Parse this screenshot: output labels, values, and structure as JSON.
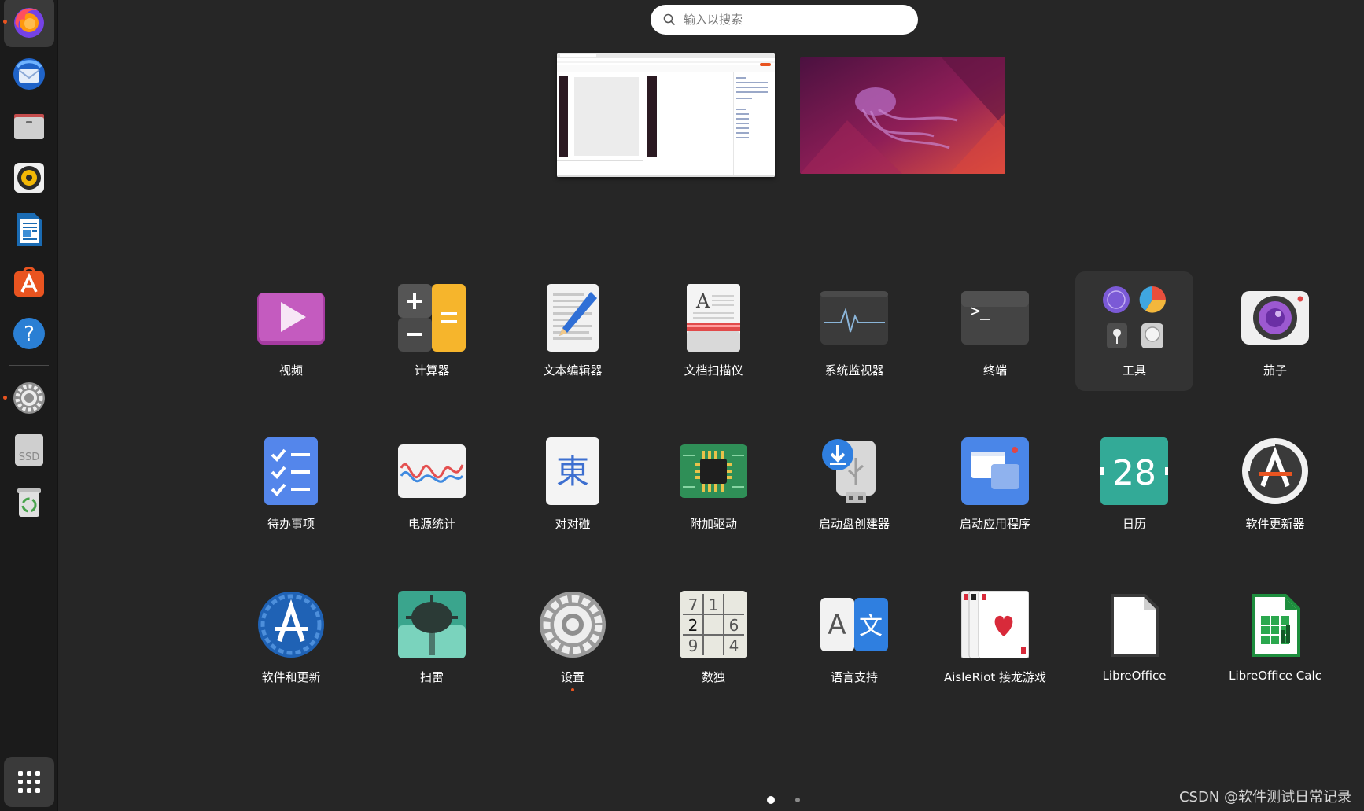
{
  "search": {
    "placeholder": "输入以搜索"
  },
  "dock": {
    "items": [
      {
        "name": "firefox",
        "icon": "firefox-icon",
        "running": true,
        "active": true
      },
      {
        "name": "thunderbird",
        "icon": "thunderbird-icon"
      },
      {
        "name": "files",
        "icon": "files-folder-icon"
      },
      {
        "name": "rhythmbox",
        "icon": "rhythmbox-speaker-icon"
      },
      {
        "name": "libreoffice-writer",
        "icon": "writer-document-icon"
      },
      {
        "name": "app-center",
        "icon": "app-center-icon"
      },
      {
        "name": "help",
        "icon": "help-icon"
      },
      {
        "name": "settings",
        "icon": "settings-gear-icon",
        "running": true
      },
      {
        "name": "ssd-drive",
        "icon": "ssd-drive-icon",
        "label": "SSD"
      },
      {
        "name": "trash",
        "icon": "trash-recycle-icon"
      },
      {
        "name": "show-apps",
        "icon": "app-grid-icon"
      }
    ]
  },
  "apps": [
    {
      "label": "视频",
      "icon": "video-play-icon"
    },
    {
      "label": "计算器",
      "icon": "calculator-icon"
    },
    {
      "label": "文本编辑器",
      "icon": "text-editor-icon"
    },
    {
      "label": "文档扫描仪",
      "icon": "document-scanner-icon"
    },
    {
      "label": "系统监视器",
      "icon": "system-monitor-icon"
    },
    {
      "label": "终端",
      "icon": "terminal-icon",
      "glyph": ">_"
    },
    {
      "label": "工具",
      "icon": "tools-folder-icon"
    },
    {
      "label": "茄子",
      "icon": "cheese-camera-icon"
    },
    {
      "label": "待办事项",
      "icon": "todo-checklist-icon"
    },
    {
      "label": "电源统计",
      "icon": "power-statistics-icon"
    },
    {
      "label": "对对碰",
      "icon": "mahjongg-tile-icon",
      "glyph": "東"
    },
    {
      "label": "附加驱动",
      "icon": "chip-driver-icon"
    },
    {
      "label": "启动盘创建器",
      "icon": "usb-creator-icon"
    },
    {
      "label": "启动应用程序",
      "icon": "startup-apps-icon"
    },
    {
      "label": "日历",
      "icon": "calendar-icon",
      "glyph": "28"
    },
    {
      "label": "软件更新器",
      "icon": "software-updater-icon"
    },
    {
      "label": "软件和更新",
      "icon": "software-properties-icon"
    },
    {
      "label": "扫雷",
      "icon": "mines-icon"
    },
    {
      "label": "设置",
      "icon": "settings-icon",
      "running": true
    },
    {
      "label": "数独",
      "icon": "sudoku-icon",
      "digits": [
        "7",
        "1",
        "2",
        "6",
        "9",
        "4"
      ]
    },
    {
      "label": "语言支持",
      "icon": "language-support-icon",
      "glyphs": [
        "A",
        "文"
      ]
    },
    {
      "label": "AisleRiot 接龙游戏",
      "icon": "aisleriot-cards-icon"
    },
    {
      "label": "LibreOffice",
      "icon": "libreoffice-icon"
    },
    {
      "label": "LibreOffice Calc",
      "icon": "libreoffice-calc-icon"
    }
  ],
  "pages": {
    "total": 2,
    "current": 1
  },
  "watermark": "CSDN @软件测试日常记录",
  "colors": {
    "accent": "#e95420",
    "background": "#262626",
    "dock": "#1b1b1b"
  }
}
